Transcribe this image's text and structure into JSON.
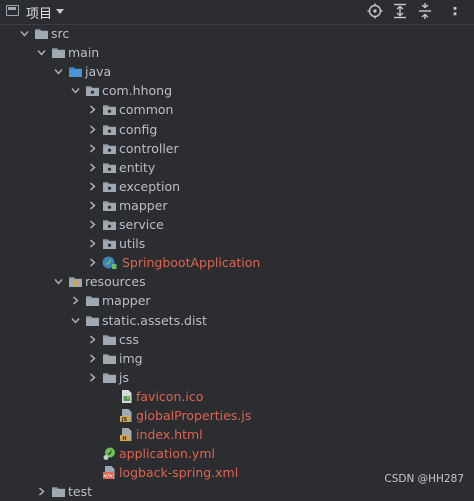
{
  "header": {
    "title": "项目",
    "tools": [
      "locate-icon",
      "expand-all-icon",
      "collapse-all-icon"
    ]
  },
  "tree": [
    {
      "name": "src",
      "icon": "folder-icon",
      "expanded": true,
      "depth": 0,
      "color": "default"
    },
    {
      "name": "main",
      "icon": "folder-icon",
      "expanded": true,
      "depth": 1,
      "color": "default"
    },
    {
      "name": "java",
      "icon": "source-folder-icon",
      "expanded": true,
      "depth": 2,
      "color": "default"
    },
    {
      "name": "com.hhong",
      "icon": "package-icon",
      "expanded": true,
      "depth": 3,
      "color": "default"
    },
    {
      "name": "common",
      "icon": "package-icon",
      "expanded": false,
      "depth": 4,
      "color": "default"
    },
    {
      "name": "config",
      "icon": "package-icon",
      "expanded": false,
      "depth": 4,
      "color": "default"
    },
    {
      "name": "controller",
      "icon": "package-icon",
      "expanded": false,
      "depth": 4,
      "color": "default"
    },
    {
      "name": "entity",
      "icon": "package-icon",
      "expanded": false,
      "depth": 4,
      "color": "default"
    },
    {
      "name": "exception",
      "icon": "package-icon",
      "expanded": false,
      "depth": 4,
      "color": "default"
    },
    {
      "name": "mapper",
      "icon": "package-icon",
      "expanded": false,
      "depth": 4,
      "color": "default"
    },
    {
      "name": "service",
      "icon": "package-icon",
      "expanded": false,
      "depth": 4,
      "color": "default"
    },
    {
      "name": "utils",
      "icon": "package-icon",
      "expanded": false,
      "depth": 4,
      "color": "default"
    },
    {
      "name": "SpringbootApplication",
      "icon": "spring-class-icon",
      "expanded": false,
      "depth": 4,
      "color": "#e0634f"
    },
    {
      "name": "resources",
      "icon": "resources-folder-icon",
      "expanded": true,
      "depth": 2,
      "color": "default"
    },
    {
      "name": "mapper",
      "icon": "folder-icon",
      "expanded": false,
      "depth": 3,
      "color": "default"
    },
    {
      "name": "static.assets.dist",
      "icon": "folder-icon",
      "expanded": true,
      "depth": 3,
      "color": "default"
    },
    {
      "name": "css",
      "icon": "folder-icon",
      "expanded": false,
      "depth": 4,
      "color": "default"
    },
    {
      "name": "img",
      "icon": "folder-icon",
      "expanded": false,
      "depth": 4,
      "color": "default"
    },
    {
      "name": "js",
      "icon": "folder-icon",
      "expanded": false,
      "depth": 4,
      "color": "default"
    },
    {
      "name": "favicon.ico",
      "icon": "image-file-icon",
      "expanded": null,
      "depth": 5,
      "color": "#e0634f"
    },
    {
      "name": "globalProperties.js",
      "icon": "js-file-icon",
      "expanded": null,
      "depth": 5,
      "color": "#e0634f"
    },
    {
      "name": "index.html",
      "icon": "html-file-icon",
      "expanded": null,
      "depth": 5,
      "color": "#e0634f"
    },
    {
      "name": "application.yml",
      "icon": "yml-file-icon",
      "expanded": null,
      "depth": 4,
      "color": "#e0634f"
    },
    {
      "name": "logback-spring.xml",
      "icon": "xml-file-icon",
      "expanded": null,
      "depth": 4,
      "color": "#e0634f"
    },
    {
      "name": "test",
      "icon": "folder-icon",
      "expanded": false,
      "depth": 1,
      "color": "default"
    }
  ],
  "watermark": "CSDN @HH287"
}
